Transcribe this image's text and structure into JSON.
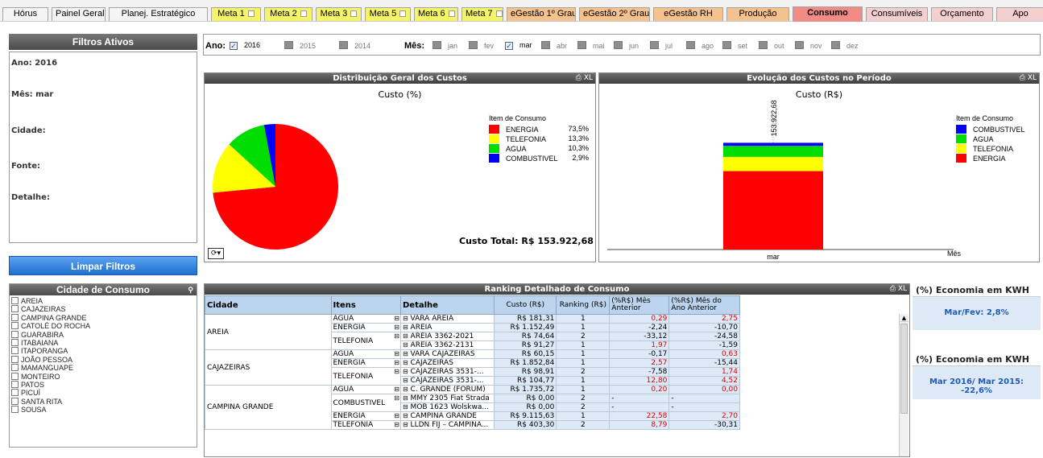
{
  "tabs": [
    {
      "label": "Hórus",
      "bg": "#f4f4f4",
      "check": false
    },
    {
      "label": "Painel Geral",
      "bg": "#f4f4f4",
      "check": true
    },
    {
      "label": "Planej. Estratégico",
      "bg": "#f4f4f4",
      "check": false
    },
    {
      "label": "Meta 1",
      "bg": "#f5f36a",
      "check": true
    },
    {
      "label": "Meta 2",
      "bg": "#f5f36a",
      "check": true
    },
    {
      "label": "Meta 3",
      "bg": "#f5f36a",
      "check": true
    },
    {
      "label": "Meta 5",
      "bg": "#f5f36a",
      "check": true
    },
    {
      "label": "Meta 6",
      "bg": "#f5f36a",
      "check": true
    },
    {
      "label": "Meta 7",
      "bg": "#f5f36a",
      "check": true
    },
    {
      "label": "eGestão 1º Grau",
      "bg": "#f3c28f",
      "check": false
    },
    {
      "label": "eGestão 2º Grau",
      "bg": "#f3c28f",
      "check": false
    },
    {
      "label": "eGestão RH",
      "bg": "#f3c28f",
      "check": false
    },
    {
      "label": "Produção",
      "bg": "#f3c28f",
      "check": false
    },
    {
      "label": "Consumo",
      "bg": "#f08b85",
      "check": false,
      "active": true
    },
    {
      "label": "Consumíveis",
      "bg": "#f4cfcf",
      "check": false
    },
    {
      "label": "Orçamento",
      "bg": "#f4cfcf",
      "check": false
    },
    {
      "label": "Apo",
      "bg": "#f4cfcf",
      "check": false
    }
  ],
  "filters": {
    "title": "Filtros Ativos",
    "rows": [
      "Ano: 2016",
      "Mês: mar",
      "Cidade:",
      "Fonte:",
      "Detalhe:"
    ],
    "clear_button": "Limpar Filtros"
  },
  "selector": {
    "year_label": "Ano:",
    "years": [
      {
        "label": "2016",
        "checked": true
      },
      {
        "label": "2015",
        "checked": false
      },
      {
        "label": "2014",
        "checked": false
      }
    ],
    "month_label": "Mês:",
    "months": [
      {
        "label": "jan",
        "checked": false
      },
      {
        "label": "fev",
        "checked": false
      },
      {
        "label": "mar",
        "checked": true
      },
      {
        "label": "abr",
        "checked": false
      },
      {
        "label": "mai",
        "checked": false
      },
      {
        "label": "jun",
        "checked": false
      },
      {
        "label": "jul",
        "checked": false
      },
      {
        "label": "ago",
        "checked": false
      },
      {
        "label": "set",
        "checked": false
      },
      {
        "label": "out",
        "checked": false
      },
      {
        "label": "nov",
        "checked": false
      },
      {
        "label": "dez",
        "checked": false
      }
    ]
  },
  "pie_panel": {
    "title": "Distribuição Geral dos Custos",
    "xl": "XL",
    "total_label": "Custo Total: R$ 153.922,68"
  },
  "bar_panel": {
    "title": "Evolução dos Custos no Período",
    "xl": "XL"
  },
  "chart_data": [
    {
      "type": "pie",
      "title": "Custo (%)",
      "legend_title": "Item de Consumo",
      "labels": [
        "ENERGIA",
        "TELEFONIA",
        "AGUA",
        "COMBUSTIVEL"
      ],
      "values": [
        73.5,
        13.3,
        10.3,
        2.9
      ],
      "value_labels": [
        "73,5%",
        "13,3%",
        "10,3%",
        "2,9%"
      ],
      "colors": [
        "#ff0000",
        "#ffff00",
        "#00dd00",
        "#0000ff"
      ]
    },
    {
      "type": "bar",
      "title": "Custo (R$)",
      "xlabel": "Mês",
      "categories": [
        "mar"
      ],
      "legend_title": "Item de Consumo",
      "stack_total_label": "153.922,68",
      "series": [
        {
          "name": "ENERGIA",
          "color": "#ff0000",
          "values": [
            113133.17
          ]
        },
        {
          "name": "TELEFONIA",
          "color": "#ffff00",
          "values": [
            20471.72
          ]
        },
        {
          "name": "AGUA",
          "color": "#00dd00",
          "values": [
            15854.04
          ]
        },
        {
          "name": "COMBUSTIVEL",
          "color": "#0000ff",
          "values": [
            4463.76
          ]
        }
      ],
      "legend_order": [
        "COMBUSTIVEL",
        "AGUA",
        "TELEFONIA",
        "ENERGIA"
      ]
    }
  ],
  "city_list": {
    "title": "Cidade de Consumo",
    "items": [
      "AREIA",
      "CAJAZEIRAS",
      "CAMPINA GRANDE",
      "CATOLÉ DO ROCHA",
      "GUARABIRA",
      "ITABAIANA",
      "ITAPORANGA",
      "JOÃO PESSOA",
      "MAMANGUAPE",
      "MONTEIRO",
      "PATOS",
      "PICUÍ",
      "SANTA RITA",
      "SOUSA"
    ]
  },
  "ranking": {
    "title": "Ranking Detalhado de Consumo",
    "xl": "XL",
    "headers": [
      "Cidade",
      "Itens",
      "Detalhe",
      "Custo (R$)",
      "Ranking (R$)",
      "(%R$) Mês Anterior",
      "(%R$) Mês do Ano Anterior"
    ],
    "rows": [
      {
        "city": "AREIA",
        "item": "AGUA",
        "detail": "VARA AREIA",
        "cost": "R$ 181,31",
        "rank": "1",
        "mom": "0,29",
        "yoy": "2,75",
        "mom_red": true,
        "yoy_red": true
      },
      {
        "city": "",
        "item": "ENERGIA",
        "detail": "AREIA",
        "cost": "R$ 1.152,49",
        "rank": "1",
        "mom": "-2,24",
        "yoy": "-10,70"
      },
      {
        "city": "",
        "item": "TELEFONIA",
        "detail": "AREIA 3362-2021",
        "cost": "R$ 74,64",
        "rank": "2",
        "mom": "-33,12",
        "yoy": "-24,58"
      },
      {
        "city": "",
        "item": "",
        "detail": "AREIA 3362-2131",
        "cost": "R$ 91,27",
        "rank": "1",
        "mom": "1,97",
        "yoy": "-1,59",
        "mom_red": true
      },
      {
        "city": "CAJAZEIRAS",
        "item": "AGUA",
        "detail": "VARA CAJAZEIRAS",
        "cost": "R$ 60,15",
        "rank": "1",
        "mom": "-0,17",
        "yoy": "0,63",
        "yoy_red": true
      },
      {
        "city": "",
        "item": "ENERGIA",
        "detail": "CAJAZEIRAS",
        "cost": "R$ 1.852,84",
        "rank": "1",
        "mom": "2,57",
        "yoy": "-15,44",
        "mom_red": true
      },
      {
        "city": "",
        "item": "TELEFONIA",
        "detail": "CAJAZEIRAS 3531-...",
        "cost": "R$ 98,91",
        "rank": "2",
        "mom": "-7,58",
        "yoy": "1,74",
        "yoy_red": true
      },
      {
        "city": "",
        "item": "",
        "detail": "CAJAZEIRAS 3531-...",
        "cost": "R$ 104,77",
        "rank": "1",
        "mom": "12,80",
        "yoy": "4,52",
        "mom_red": true,
        "yoy_red": true
      },
      {
        "city": "CAMPINA GRANDE",
        "item": "AGUA",
        "detail": "C. GRANDE (FÓRUM)",
        "cost": "R$ 1.735,72",
        "rank": "1",
        "mom": "0,20",
        "yoy": "0,00",
        "mom_red": true,
        "yoy_red": true
      },
      {
        "city": "",
        "item": "COMBUSTIVEL",
        "detail": "MMY 2305 Fiat Strada",
        "cost": "R$ 0,00",
        "rank": "2",
        "mom": "-",
        "yoy": "-"
      },
      {
        "city": "",
        "item": "",
        "detail": "MOB 1623 Wolskwa...",
        "cost": "R$ 0,00",
        "rank": "2",
        "mom": "-",
        "yoy": "-"
      },
      {
        "city": "",
        "item": "ENERGIA",
        "detail": "CAMPINA GRANDE",
        "cost": "R$ 9.115,63",
        "rank": "1",
        "mom": "22,58",
        "yoy": "2,70",
        "mom_red": true,
        "yoy_red": true
      },
      {
        "city": "",
        "item": "TELEFONIA",
        "detail": "LLDN FIJ – CAMPINA...",
        "cost": "R$ 403,30",
        "rank": "2",
        "mom": "8,79",
        "yoy": "-30,31",
        "mom_red": true
      }
    ]
  },
  "kpi1": {
    "title": "(%) Economia em KWH",
    "value": "Mar/Fev: 2,8%"
  },
  "kpi2": {
    "title": "(%) Economia em KWH",
    "value": "Mar 2016/ Mar 2015: -22,6%"
  }
}
